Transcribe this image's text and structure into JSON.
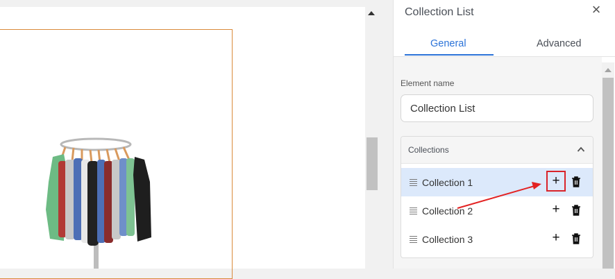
{
  "panel": {
    "title": "Collection List",
    "tabs": [
      {
        "label": "General",
        "active": true
      },
      {
        "label": "Advanced",
        "active": false
      }
    ],
    "element_name": {
      "label": "Element name",
      "value": "Collection List"
    },
    "collections": {
      "title": "Collections",
      "items": [
        {
          "label": "Collection 1",
          "selected": true
        },
        {
          "label": "Collection 2",
          "selected": false
        },
        {
          "label": "Collection 3",
          "selected": false
        }
      ]
    }
  },
  "colors": {
    "accent": "#2b73d8",
    "selected_row": "#dce9fb",
    "annotation": "#e32222",
    "frame_border": "#d98a3a"
  },
  "icons": {
    "close": "close-icon",
    "collapse": "chevron-up-icon",
    "drag": "drag-handle-icon",
    "add": "plus-icon",
    "delete": "trash-icon"
  }
}
